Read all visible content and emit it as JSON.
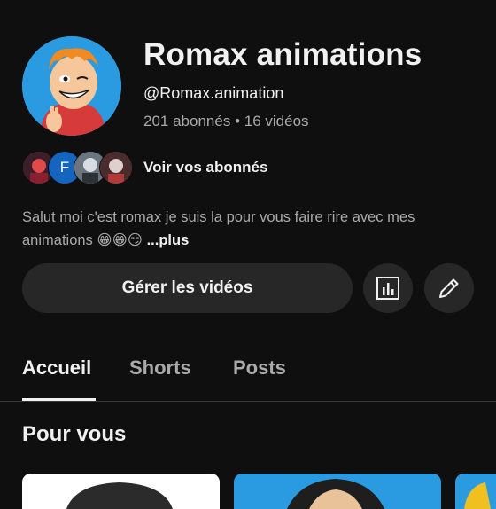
{
  "channel": {
    "name": "Romax animations",
    "handle": "@Romax.animation",
    "subscribers": "201 abonnés",
    "separator": "•",
    "videos": "16 vidéos"
  },
  "subscribers_row": {
    "label": "Voir vos abonnés",
    "avatars": [
      {
        "icon": "subscriber-avatar-1"
      },
      {
        "letter": "F",
        "color": "#1565c0"
      },
      {
        "icon": "subscriber-avatar-3"
      },
      {
        "icon": "subscriber-avatar-4"
      }
    ]
  },
  "description": {
    "text": "Salut moi c'est romax je suis la pour vous faire rire avec mes animations",
    "emojis": "😁😁😏",
    "more": "...plus"
  },
  "actions": {
    "manage_label": "Gérer les vidéos",
    "analytics_icon": "analytics-icon",
    "edit_icon": "pencil-icon"
  },
  "tabs": [
    {
      "label": "Accueil",
      "active": true
    },
    {
      "label": "Shorts",
      "active": false
    },
    {
      "label": "Posts",
      "active": false
    }
  ],
  "section": {
    "title": "Pour vous"
  },
  "colors": {
    "background": "#0f0f0f",
    "button": "#272727",
    "text": "#f1f1f1",
    "secondary_text": "#aaaaaa"
  }
}
